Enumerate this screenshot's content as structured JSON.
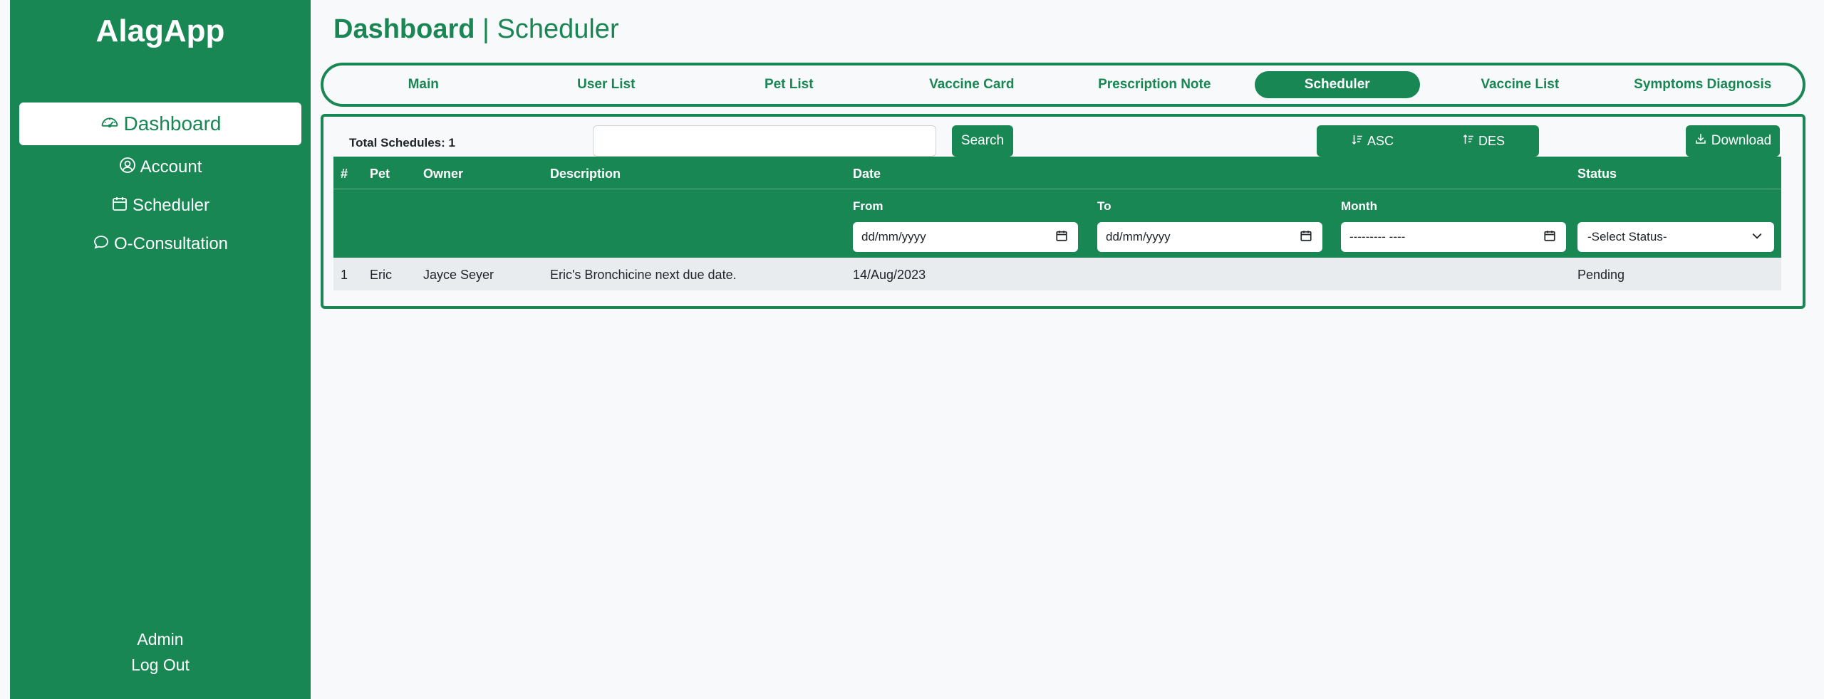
{
  "sidebar": {
    "brand": "AlagApp",
    "items": [
      {
        "label": "Dashboard",
        "icon": "speedometer-icon",
        "active": true
      },
      {
        "label": "Account",
        "icon": "person-circle-icon"
      },
      {
        "label": "Scheduler",
        "icon": "calendar-icon"
      },
      {
        "label": "O-Consultation",
        "icon": "chat-icon"
      }
    ],
    "bottom": {
      "admin": "Admin",
      "logout": "Log Out"
    }
  },
  "header": {
    "title_bold": "Dashboard",
    "separator": " | ",
    "title_sub": "Scheduler"
  },
  "tabs": [
    {
      "label": "Main"
    },
    {
      "label": "User List"
    },
    {
      "label": "Pet List"
    },
    {
      "label": "Vaccine Card"
    },
    {
      "label": "Prescription Note"
    },
    {
      "label": "Scheduler",
      "active": true
    },
    {
      "label": "Vaccine List"
    },
    {
      "label": "Symptoms Diagnosis"
    }
  ],
  "toolbar": {
    "total_label": "Total Schedules: 1",
    "search_value": "",
    "search_label": "Search",
    "asc_label": "ASC",
    "des_label": "DES",
    "download_label": "Download"
  },
  "table": {
    "columns": {
      "num": "#",
      "pet": "Pet",
      "owner": "Owner",
      "description": "Description",
      "date": "Date",
      "status": "Status"
    },
    "filters": {
      "from_label": "From",
      "from_placeholder": "dd/mm/yyyy",
      "to_label": "To",
      "to_placeholder": "dd/mm/yyyy",
      "month_label": "Month",
      "month_placeholder": "--------- ----",
      "status_placeholder": "-Select Status-"
    },
    "rows": [
      {
        "num": "1",
        "pet": "Eric",
        "owner": "Jayce Seyer",
        "description": "Eric's Bronchicine next due date.",
        "date": "14/Aug/2023",
        "status": "Pending"
      }
    ]
  },
  "colors": {
    "primary": "#198754",
    "background": "#f8f9fa",
    "row": "#e9ecef"
  }
}
